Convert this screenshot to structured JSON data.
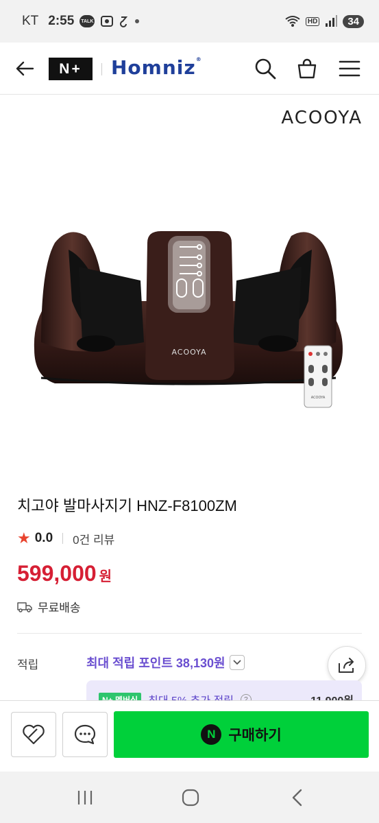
{
  "status_bar": {
    "carrier": "KT",
    "time": "2:55",
    "talk_badge": "TALK",
    "network": "HD",
    "battery": "34"
  },
  "header": {
    "nplus_logo": "N+",
    "brand_logo": "Homniz",
    "icons": [
      "back-arrow-icon",
      "search-icon",
      "shopping-bag-icon",
      "menu-icon"
    ]
  },
  "hero": {
    "brand_mark": "ACOOYA"
  },
  "product": {
    "title": "치고야 발마사지기 HNZ-F8100ZM",
    "rating": "0.0",
    "review_count": "0건 리뷰",
    "price": "599,000",
    "price_unit": "원",
    "shipping": "무료배송"
  },
  "points": {
    "label": "적립",
    "max_points": "최대 적립 포인트 38,130원",
    "promo_badge": "N+",
    "promo_tag": "멤버십",
    "promo_text": "최대 5% 추가 적립",
    "promo_amount": "11,900원"
  },
  "action_bar": {
    "buy_label": "구매하기",
    "buy_logo": "N"
  },
  "colors": {
    "price": "#d61f34",
    "buy_button": "#00d03a",
    "points_accent": "#6a4ed0",
    "star": "#e8432e"
  }
}
